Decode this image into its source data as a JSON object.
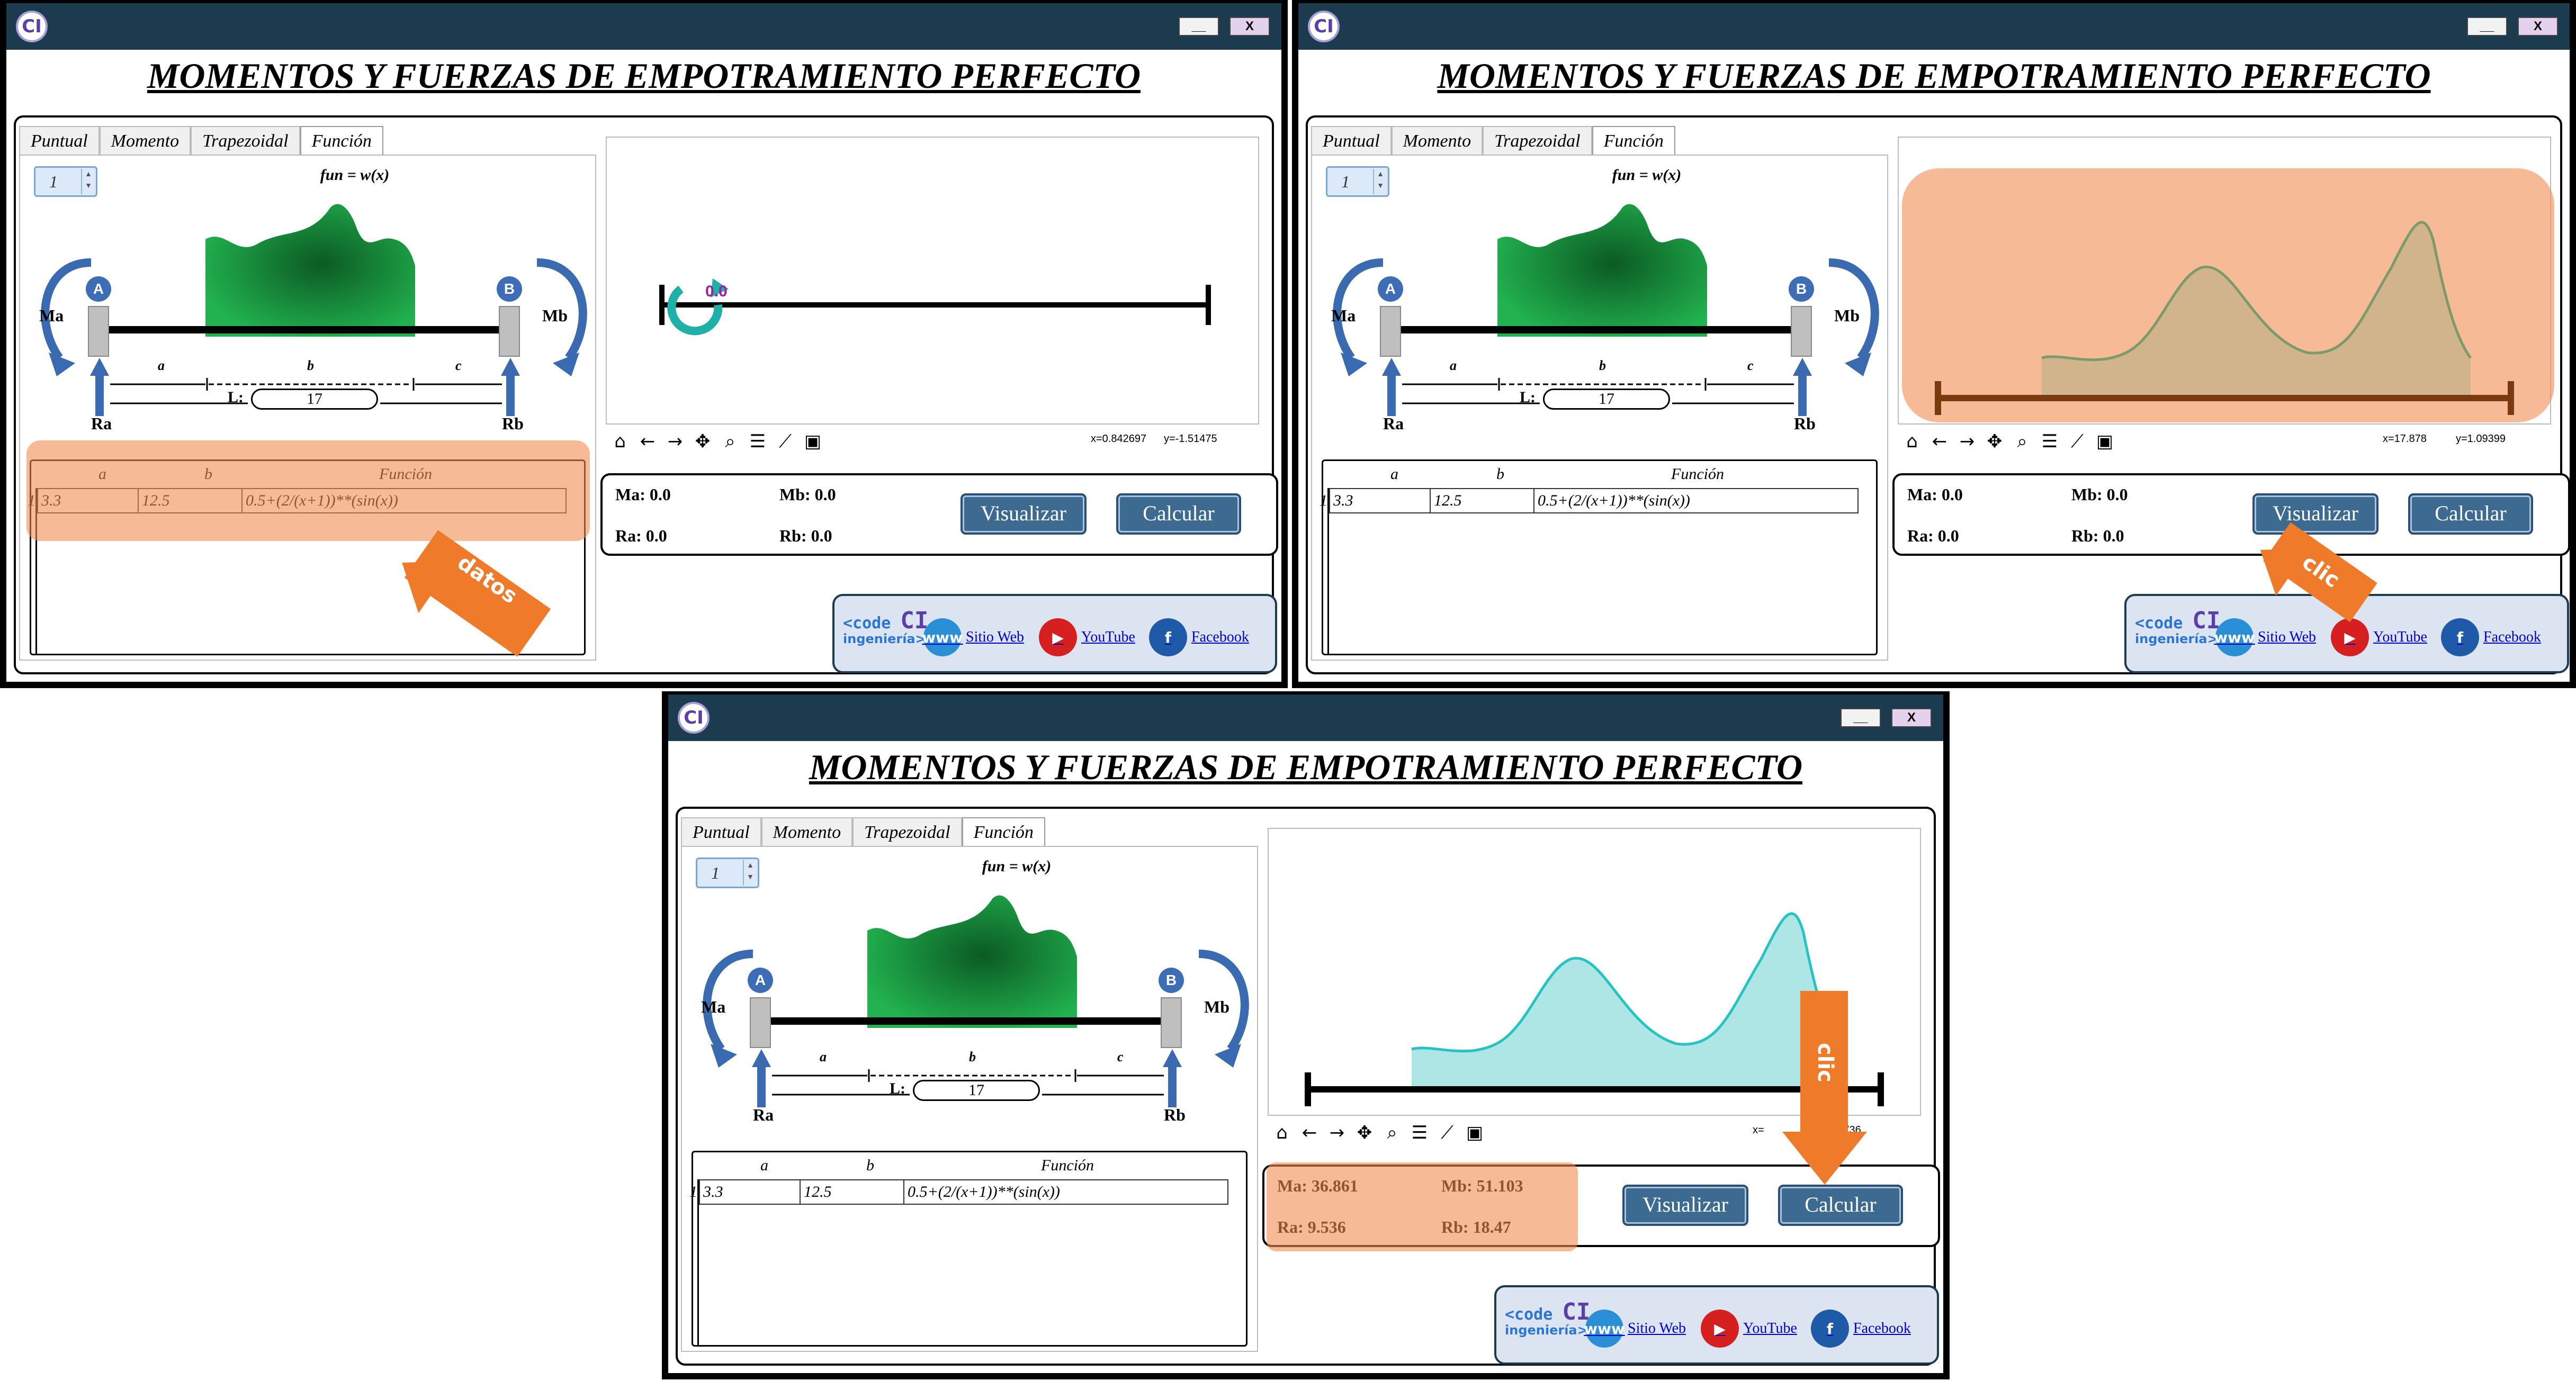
{
  "window": {
    "title": "MOMENTOS Y FUERZAS DE EMPOTRAMIENTO PERFECTO",
    "logo_text": "CI",
    "minimize_label": "__",
    "close_label": "X"
  },
  "tabs": [
    "Puntual",
    "Momento",
    "Trapezoidal",
    "Función"
  ],
  "spinner_value": "1",
  "fun_label": "fun = w(x)",
  "beam_labels": {
    "A": "A",
    "B": "B",
    "Ma": "Ma",
    "Mb": "Mb",
    "Ra": "Ra",
    "Rb": "Rb",
    "a": "a",
    "b": "b",
    "c": "c",
    "L": "L:",
    "L_value": "17"
  },
  "table": {
    "headers": [
      "a",
      "b",
      "Función"
    ],
    "row_index": "1",
    "row": [
      "3.3",
      "12.5",
      "0.5+(2/(x+1))**(sin(x))"
    ]
  },
  "toolbar_icons": [
    "home-icon",
    "back-arrow-icon",
    "forward-arrow-icon",
    "pan-icon",
    "zoom-icon",
    "configure-icon",
    "edit-axes-icon",
    "save-icon"
  ],
  "buttons": {
    "visualize": "Visualizar",
    "calculate": "Calcular"
  },
  "links": {
    "brand_top": "<code",
    "brand_ci": "CI",
    "brand_sub": "ingeniería>",
    "web": "Sitio Web",
    "youtube": "YouTube",
    "facebook": "Facebook"
  },
  "panels": [
    {
      "coords": {
        "x": "x=0.842697",
        "y": "y=-1.51475"
      },
      "plot_marker": "0.0",
      "results": {
        "Ma": "Ma: 0.0",
        "Mb": "Mb: 0.0",
        "Ra": "Ra: 0.0",
        "Rb": "Rb: 0.0"
      },
      "callout": "datos"
    },
    {
      "coords": {
        "x": "x=17.878",
        "y": "y=1.09399"
      },
      "results": {
        "Ma": "Ma: 0.0",
        "Mb": "Mb: 0.0",
        "Ra": "Ra: 0.0",
        "Rb": "Rb: 0.0"
      },
      "callout": "clic"
    },
    {
      "coords": {
        "x": "x=",
        "y": "526736"
      },
      "results": {
        "Ma": "Ma: 36.861",
        "Mb": "Mb: 51.103",
        "Ra": "Ra: 9.536",
        "Rb": "Rb: 18.47"
      },
      "callout": "clic"
    }
  ],
  "colors": {
    "titlebar": "#1d3b4f",
    "button": "#3d6a91",
    "load_fill": "#1aa44a",
    "highlight": "#f08c50",
    "plot_curve_2": "#7c9a6a",
    "plot_curve_3": "#27c3c3",
    "beam_line": "#000000"
  }
}
